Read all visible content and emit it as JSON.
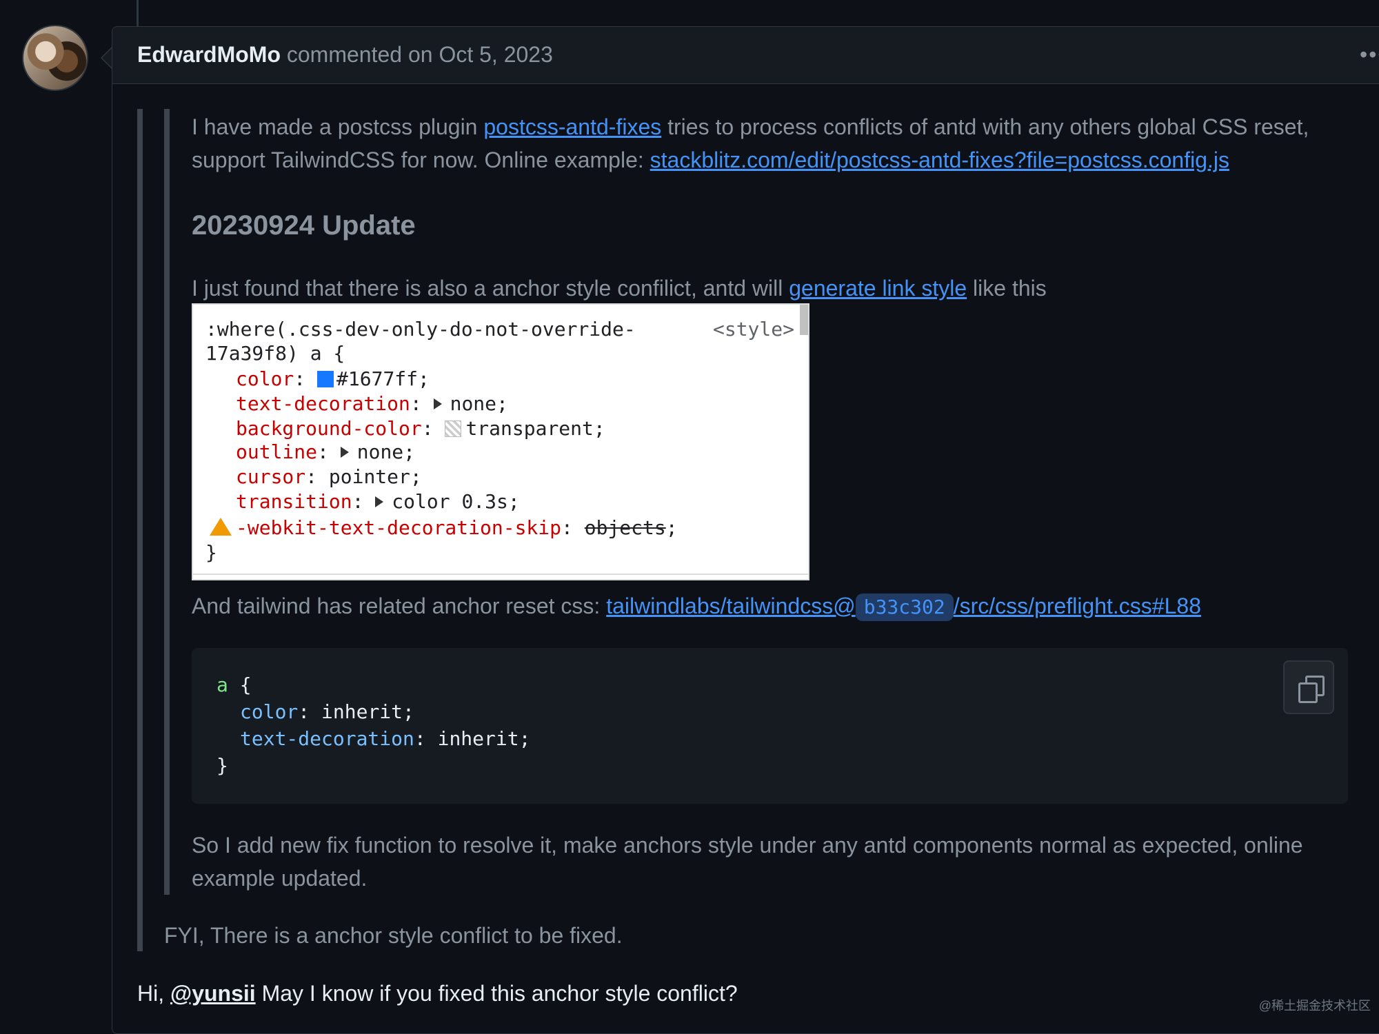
{
  "comment": {
    "author": "EdwardMoMo",
    "meta": "commented on Oct 5, 2023",
    "menu": "•••"
  },
  "body": {
    "p1_a": "I have made a postcss plugin ",
    "p1_link": "postcss-antd-fixes",
    "p1_b": " tries to process conflicts of antd with any others global CSS reset,",
    "p1_c": "support TailwindCSS for now. Online example: ",
    "p1_link2": "stackblitz.com/edit/postcss-antd-fixes?file=postcss.config.js",
    "update_heading": "20230924 Update",
    "p2_a": "I just found that there is also a anchor style confilict, antd will ",
    "p2_link": "generate link style",
    "p2_b": " like this",
    "p3_a": "And tailwind has related anchor reset css: ",
    "p3_link_a": "tailwindlabs/tailwindcss@",
    "p3_sha": "b33c302",
    "p3_link_b": "/src/css/preflight.css#L88",
    "p4": "So I add new fix function to resolve it, make anchors style under any antd components normal as expected, online",
    "p4b": "example updated.",
    "p5": "FYI, There is a anchor style conflict to be fixed.",
    "p6_a": "Hi, ",
    "p6_mention": "@yunsii",
    "p6_b": " May I know if you fixed this anchor style conflict?"
  },
  "devtools": {
    "selector_1": ":where(.css-dev-only-do-not-override-",
    "selector_2": "17a39f8) a {",
    "style_tag": "<style>",
    "rules": [
      {
        "prop": "color",
        "value": "#1677ff;"
      },
      {
        "prop": "text-decoration",
        "value": "none;"
      },
      {
        "prop": "background-color",
        "value": "transparent;"
      },
      {
        "prop": "outline",
        "value": "none;"
      },
      {
        "prop": "cursor",
        "value": "pointer;"
      },
      {
        "prop": "transition",
        "value": "color 0.3s;"
      },
      {
        "prop": "-webkit-text-decoration-skip",
        "value": "objects"
      }
    ],
    "close": "}",
    "swatch_color": "#1677ff"
  },
  "code": {
    "line1_sel": "a",
    "line1_rest": " {",
    "line2_prop": "color",
    "line2_rest": ": inherit;",
    "line3_prop": "text-decoration",
    "line3_rest": ": inherit;",
    "line4": "}"
  },
  "watermark": "@稀土掘金技术社区"
}
